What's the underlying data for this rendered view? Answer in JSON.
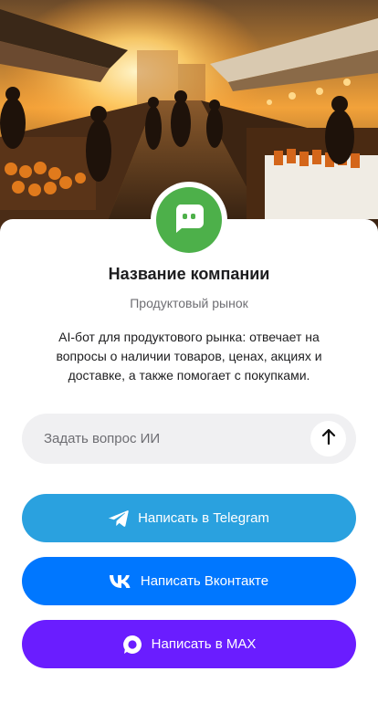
{
  "company": {
    "name": "Название компании",
    "type": "Продуктовый рынок",
    "description": "AI-бот для продуктового рынка: отвечает на вопросы о наличии товаров, ценах, акциях и доставке, а также помогает с покупками."
  },
  "ask": {
    "placeholder": "Задать вопрос ИИ"
  },
  "actions": {
    "telegram_label": "Написать в Telegram",
    "vk_label": "Написать Вконтакте",
    "max_label": "Написать в MAX"
  },
  "colors": {
    "avatar_green": "#4db04a",
    "telegram": "#2aa1df",
    "vk": "#0077ff",
    "max": "#6a1dff",
    "input_bg": "#f0f0f2"
  },
  "icons": {
    "avatar": "chat-bot-icon",
    "send": "arrow-up-icon",
    "telegram": "telegram-icon",
    "vk": "vk-icon",
    "max": "max-icon"
  }
}
